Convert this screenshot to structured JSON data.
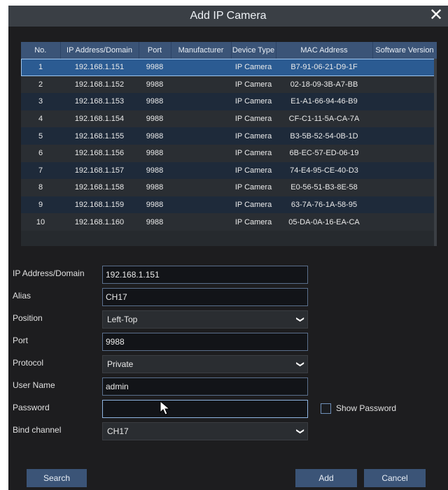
{
  "dialog": {
    "title": "Add IP Camera",
    "close_glyph": "✕"
  },
  "table": {
    "columns": [
      "No.",
      "IP Address/Domain",
      "Port",
      "Manufacturer",
      "Device Type",
      "MAC Address",
      "Software Version"
    ],
    "rows": [
      [
        "1",
        "192.168.1.151",
        "9988",
        "",
        "IP Camera",
        "B7-91-06-21-D9-1F",
        ""
      ],
      [
        "2",
        "192.168.1.152",
        "9988",
        "",
        "IP Camera",
        "02-18-09-3B-A7-BB",
        ""
      ],
      [
        "3",
        "192.168.1.153",
        "9988",
        "",
        "IP Camera",
        "E1-A1-66-94-46-B9",
        ""
      ],
      [
        "4",
        "192.168.1.154",
        "9988",
        "",
        "IP Camera",
        "CF-C1-11-5A-CA-7A",
        ""
      ],
      [
        "5",
        "192.168.1.155",
        "9988",
        "",
        "IP Camera",
        "B3-5B-52-54-0B-1D",
        ""
      ],
      [
        "6",
        "192.168.1.156",
        "9988",
        "",
        "IP Camera",
        "6B-EC-57-ED-06-19",
        ""
      ],
      [
        "7",
        "192.168.1.157",
        "9988",
        "",
        "IP Camera",
        "74-E4-95-CE-40-D3",
        ""
      ],
      [
        "8",
        "192.168.1.158",
        "9988",
        "",
        "IP Camera",
        "E0-56-51-B3-8E-58",
        ""
      ],
      [
        "9",
        "192.168.1.159",
        "9988",
        "",
        "IP Camera",
        "63-7A-76-1A-58-95",
        ""
      ],
      [
        "10",
        "192.168.1.160",
        "9988",
        "",
        "IP Camera",
        "05-DA-0A-16-EA-CA",
        ""
      ]
    ],
    "selected_row": 0
  },
  "form": {
    "ip": {
      "label": "IP Address/Domain",
      "value": "192.168.1.151"
    },
    "alias": {
      "label": "Alias",
      "value": "CH17"
    },
    "position": {
      "label": "Position",
      "value": "Left-Top"
    },
    "port": {
      "label": "Port",
      "value": "9988"
    },
    "protocol": {
      "label": "Protocol",
      "value": "Private"
    },
    "username": {
      "label": "User Name",
      "value": "admin"
    },
    "password": {
      "label": "Password",
      "value": ""
    },
    "show_password": {
      "label": "Show Password",
      "checked": false
    },
    "bind_channel": {
      "label": "Bind channel",
      "value": "CH17"
    }
  },
  "buttons": {
    "search": "Search",
    "add": "Add",
    "cancel": "Cancel"
  },
  "icons": {
    "close": "close-icon",
    "dropdown": "chevron-down-icon",
    "cursor": "mouse-pointer-icon",
    "checkbox": "checkbox-icon"
  },
  "colors": {
    "accent": "#3b5477",
    "selected_row": "#2b5b92",
    "background": "#1d1d1f"
  }
}
